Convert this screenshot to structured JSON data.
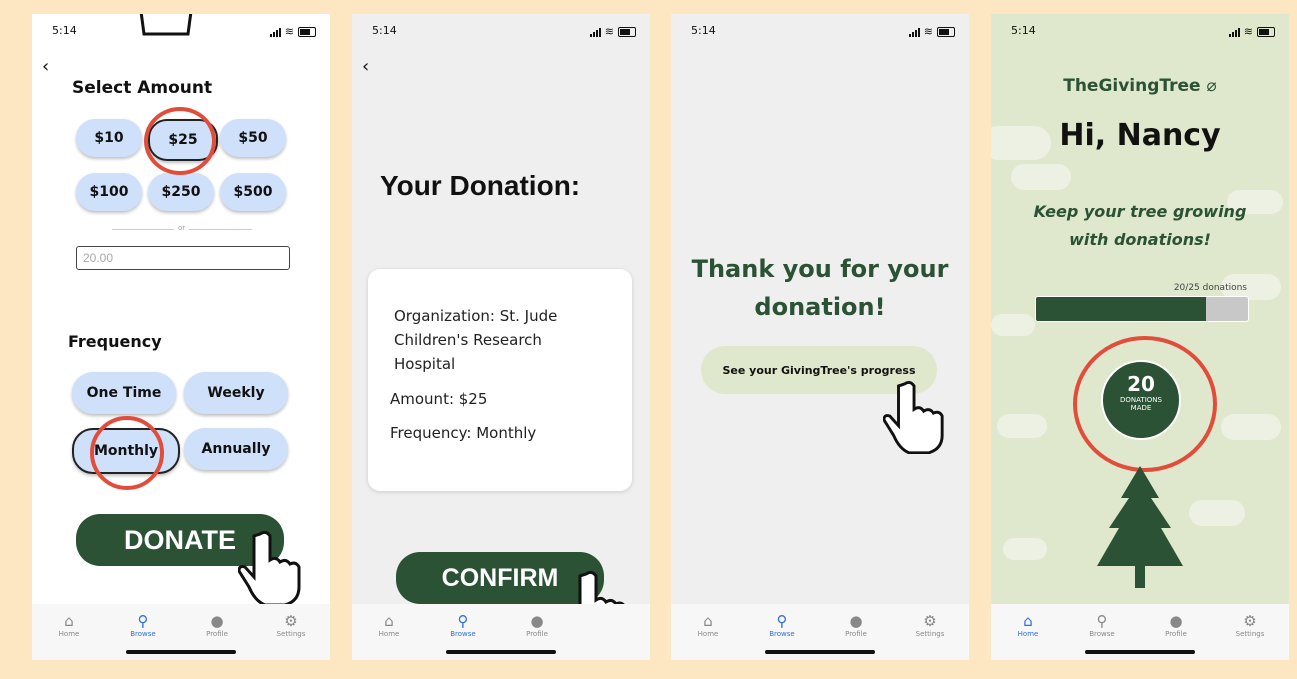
{
  "status": {
    "time": "5:14"
  },
  "tabs": [
    {
      "label": "Home",
      "icon": "home-icon"
    },
    {
      "label": "Browse",
      "icon": "search-icon"
    },
    {
      "label": "Profile",
      "icon": "profile-icon"
    },
    {
      "label": "Settings",
      "icon": "gear-icon"
    }
  ],
  "screen1": {
    "title": "Select Amount",
    "amounts": [
      "$10",
      "$25",
      "$50",
      "$100",
      "$250",
      "$500"
    ],
    "or": "or",
    "custom_amount_value": "20.00",
    "frequency_title": "Frequency",
    "frequencies": [
      "One Time",
      "Weekly",
      "Monthly",
      "Annually"
    ],
    "donate_label": "DONATE"
  },
  "screen2": {
    "title": "Your Donation:",
    "org_line1": "Organization: St. Jude",
    "org_line2": "Children's Research",
    "org_line3": "Hospital",
    "amount": "Amount: $25",
    "frequency": "Frequency: Monthly",
    "confirm_label": "CONFIRM"
  },
  "screen3": {
    "title_line1": "Thank you for your",
    "title_line2": "donation!",
    "progress_button": "See your GivingTree's progress"
  },
  "screen4": {
    "brand": "TheGivingTree",
    "greeting": "Hi, Nancy",
    "tagline_line1": "Keep your tree growing",
    "tagline_line2": "with donations!",
    "progress_label": "20/25 donations",
    "progress_fraction": 0.8,
    "count": "20",
    "count_label_line1": "DONATIONS",
    "count_label_line2": "MADE"
  },
  "colors": {
    "accent": "#2b5234",
    "pill": "#cfe0fb",
    "highlight": "#e24c3a"
  }
}
